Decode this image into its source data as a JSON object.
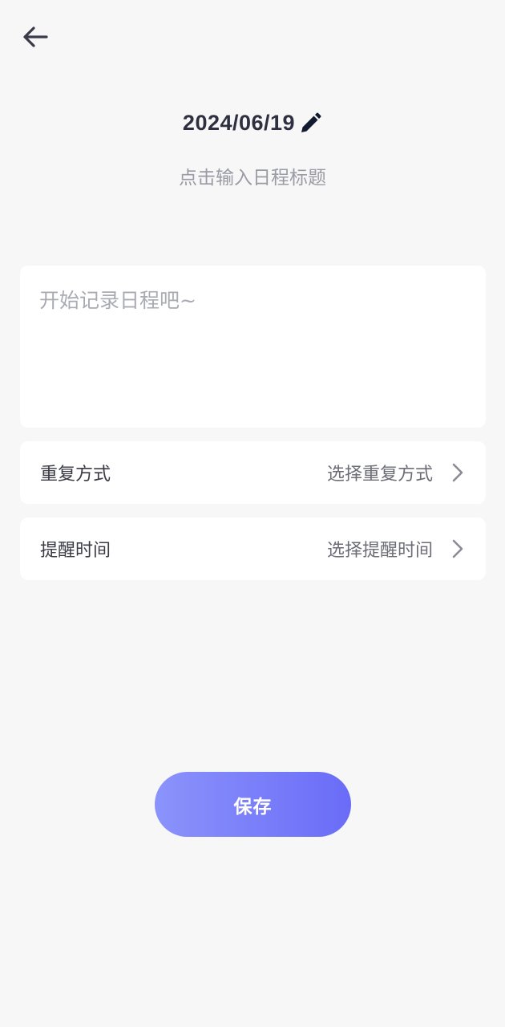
{
  "header": {
    "back_icon": "arrow-left-icon",
    "date": "2024/06/19",
    "edit_icon": "pencil-icon",
    "title_placeholder": "点击输入日程标题"
  },
  "notes": {
    "placeholder": "开始记录日程吧~",
    "value": ""
  },
  "settings": [
    {
      "label": "重复方式",
      "value": "选择重复方式",
      "icon": "chevron-right-icon"
    },
    {
      "label": "提醒时间",
      "value": "选择提醒时间",
      "icon": "chevron-right-icon"
    }
  ],
  "actions": {
    "save_label": "保存"
  },
  "colors": {
    "background": "#f7f7f7",
    "card": "#ffffff",
    "accent_start": "#8b93fb",
    "accent_end": "#6a6cf8",
    "title_text": "#2e3040",
    "placeholder_text": "#9a9ba4"
  }
}
